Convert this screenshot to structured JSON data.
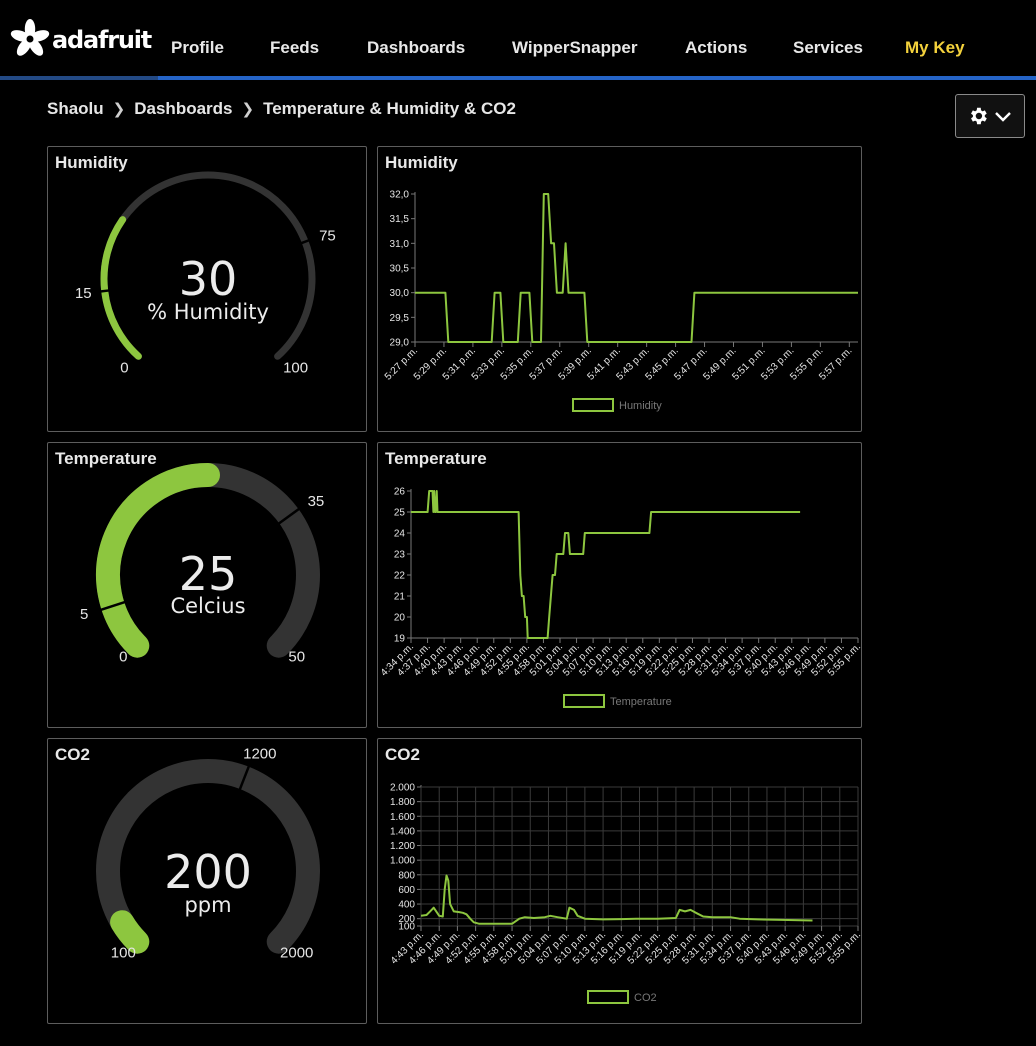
{
  "app": {
    "logo_text": "adafruit",
    "nav": [
      "Profile",
      "Feeds",
      "Dashboards",
      "WipperSnapper",
      "Actions",
      "Services",
      "My Key"
    ]
  },
  "breadcrumb": [
    "Shaolu",
    "Dashboards",
    "Temperature & Humidity & CO2"
  ],
  "settings": {
    "icon": "gear-icon",
    "chevron": "chevron-down-icon"
  },
  "colors": {
    "accent": "#8dc63f",
    "gauge_track": "#333333",
    "nav_highlight": "#f4d23c",
    "border": "#5d5d5d",
    "line": "#2564c7"
  },
  "gauges": [
    {
      "title": "Humidity",
      "value": "30",
      "unit": "% Humidity",
      "min": "0",
      "max": "100",
      "low": "15",
      "high": "75",
      "min_val": 0,
      "max_val": 100,
      "low_val": 15,
      "high_val": 75,
      "cur_val": 30
    },
    {
      "title": "Temperature",
      "value": "25",
      "unit": "Celcius",
      "min": "0",
      "max": "50",
      "low": "5",
      "high": "35",
      "min_val": 0,
      "max_val": 50,
      "low_val": 5,
      "high_val": 35,
      "cur_val": 25
    },
    {
      "title": "CO2",
      "value": "200",
      "unit": "ppm",
      "min": "100",
      "max": "2000",
      "low": "",
      "high": "1200",
      "min_val": 100,
      "max_val": 2000,
      "low_val": null,
      "high_val": 1200,
      "cur_val": 200
    }
  ],
  "chart_data": [
    {
      "type": "line",
      "title": "Humidity",
      "legend": "Humidity",
      "ylim": [
        29.0,
        32.0
      ],
      "yticks": [
        "32,0",
        "31,5",
        "31,0",
        "30,5",
        "30,0",
        "29,5",
        "29,0"
      ],
      "xticks": [
        "5:27 p.m.",
        "5:29 p.m.",
        "5:31 p.m.",
        "5:33 p.m.",
        "5:35 p.m.",
        "5:37 p.m.",
        "5:39 p.m.",
        "5:41 p.m.",
        "5:43 p.m.",
        "5:45 p.m.",
        "5:47 p.m.",
        "5:49 p.m.",
        "5:51 p.m.",
        "5:53 p.m.",
        "5:55 p.m.",
        "5:57 p.m."
      ],
      "grid": false,
      "series": [
        {
          "name": "Humidity",
          "values": [
            [
              0,
              30
            ],
            [
              1.05,
              30
            ],
            [
              1.15,
              29
            ],
            [
              2.65,
              29
            ],
            [
              2.75,
              30
            ],
            [
              2.95,
              30
            ],
            [
              3.05,
              29
            ],
            [
              3.55,
              29
            ],
            [
              3.65,
              30
            ],
            [
              3.95,
              30
            ],
            [
              4.05,
              29
            ],
            [
              4.35,
              29
            ],
            [
              4.45,
              32
            ],
            [
              4.6,
              32
            ],
            [
              4.7,
              31
            ],
            [
              4.8,
              31
            ],
            [
              4.9,
              30
            ],
            [
              5.1,
              30
            ],
            [
              5.2,
              31
            ],
            [
              5.3,
              30
            ],
            [
              5.85,
              30
            ],
            [
              5.95,
              29
            ],
            [
              9.55,
              29
            ],
            [
              9.65,
              30
            ],
            [
              15.3,
              30
            ]
          ]
        }
      ]
    },
    {
      "type": "line",
      "title": "Temperature",
      "legend": "Temperature",
      "ylim": [
        19,
        26
      ],
      "yticks": [
        "26",
        "25",
        "24",
        "23",
        "22",
        "21",
        "20",
        "19"
      ],
      "xticks": [
        "4:34 p.m.",
        "4:37 p.m.",
        "4:40 p.m.",
        "4:43 p.m.",
        "4:46 p.m.",
        "4:49 p.m.",
        "4:52 p.m.",
        "4:55 p.m.",
        "4:58 p.m.",
        "5:01 p.m.",
        "5:04 p.m.",
        "5:07 p.m.",
        "5:10 p.m.",
        "5:13 p.m.",
        "5:16 p.m.",
        "5:19 p.m.",
        "5:22 p.m.",
        "5:25 p.m.",
        "5:28 p.m.",
        "5:31 p.m.",
        "5:34 p.m.",
        "5:37 p.m.",
        "5:40 p.m.",
        "5:43 p.m.",
        "5:46 p.m.",
        "5:49 p.m.",
        "5:52 p.m.",
        "5:55 p.m."
      ],
      "grid": false,
      "series": [
        {
          "name": "Temperature",
          "values": [
            [
              0,
              25
            ],
            [
              1,
              25
            ],
            [
              1.1,
              26
            ],
            [
              1.3,
              26
            ],
            [
              1.35,
              25
            ],
            [
              1.4,
              26
            ],
            [
              1.45,
              25
            ],
            [
              1.5,
              25
            ],
            [
              1.55,
              26
            ],
            [
              1.6,
              25
            ],
            [
              6.5,
              25
            ],
            [
              6.6,
              22
            ],
            [
              6.7,
              21
            ],
            [
              6.8,
              21
            ],
            [
              6.9,
              20
            ],
            [
              7.0,
              20
            ],
            [
              7.05,
              19
            ],
            [
              8.25,
              19
            ],
            [
              8.35,
              20
            ],
            [
              8.45,
              21
            ],
            [
              8.55,
              22
            ],
            [
              8.7,
              22
            ],
            [
              8.8,
              23
            ],
            [
              9.2,
              23
            ],
            [
              9.3,
              24
            ],
            [
              9.5,
              24
            ],
            [
              9.6,
              23
            ],
            [
              10.4,
              23
            ],
            [
              10.5,
              24
            ],
            [
              14.4,
              24
            ],
            [
              14.5,
              25
            ],
            [
              23.5,
              25
            ]
          ]
        }
      ]
    },
    {
      "type": "line",
      "title": "CO2",
      "legend": "CO2",
      "ylim": [
        100,
        2000
      ],
      "yticks": [
        "2.000",
        "1.800",
        "1.600",
        "1.400",
        "1.200",
        "1.000",
        "800",
        "600",
        "400",
        "200",
        "100"
      ],
      "ytick_vals": [
        2000,
        1800,
        1600,
        1400,
        1200,
        1000,
        800,
        600,
        400,
        200,
        100
      ],
      "xticks": [
        "4:43 p.m.",
        "4:46 p.m.",
        "4:49 p.m.",
        "4:52 p.m.",
        "4:55 p.m.",
        "4:58 p.m.",
        "5:01 p.m.",
        "5:04 p.m.",
        "5:07 p.m.",
        "5:10 p.m.",
        "5:13 p.m.",
        "5:16 p.m.",
        "5:19 p.m.",
        "5:22 p.m.",
        "5:25 p.m.",
        "5:28 p.m.",
        "5:31 p.m.",
        "5:34 p.m.",
        "5:37 p.m.",
        "5:40 p.m.",
        "5:43 p.m.",
        "5:46 p.m.",
        "5:49 p.m.",
        "5:52 p.m.",
        "5:55 p.m."
      ],
      "grid": true,
      "series": [
        {
          "name": "CO2",
          "values": [
            [
              0,
              240
            ],
            [
              0.3,
              250
            ],
            [
              0.5,
              300
            ],
            [
              0.7,
              350
            ],
            [
              1.0,
              240
            ],
            [
              1.2,
              230
            ],
            [
              1.3,
              600
            ],
            [
              1.4,
              790
            ],
            [
              1.5,
              720
            ],
            [
              1.6,
              400
            ],
            [
              1.8,
              300
            ],
            [
              2.1,
              290
            ],
            [
              2.3,
              280
            ],
            [
              2.5,
              260
            ],
            [
              2.7,
              200
            ],
            [
              2.9,
              150
            ],
            [
              3.2,
              130
            ],
            [
              4.0,
              130
            ],
            [
              5.0,
              130
            ],
            [
              5.4,
              200
            ],
            [
              5.7,
              220
            ],
            [
              6.2,
              210
            ],
            [
              6.8,
              220
            ],
            [
              7.1,
              240
            ],
            [
              7.5,
              220
            ],
            [
              8.0,
              200
            ],
            [
              8.15,
              350
            ],
            [
              8.4,
              320
            ],
            [
              8.6,
              240
            ],
            [
              9.0,
              200
            ],
            [
              10.0,
              190
            ],
            [
              11.0,
              195
            ],
            [
              12.0,
              200
            ],
            [
              13.0,
              200
            ],
            [
              14.0,
              210
            ],
            [
              14.2,
              320
            ],
            [
              14.5,
              300
            ],
            [
              14.8,
              320
            ],
            [
              15.1,
              280
            ],
            [
              15.5,
              230
            ],
            [
              16.0,
              220
            ],
            [
              16.5,
              220
            ],
            [
              17.0,
              220
            ],
            [
              17.5,
              200
            ],
            [
              18.5,
              190
            ],
            [
              19.5,
              185
            ],
            [
              20.5,
              180
            ],
            [
              21.5,
              175
            ]
          ]
        }
      ]
    }
  ]
}
